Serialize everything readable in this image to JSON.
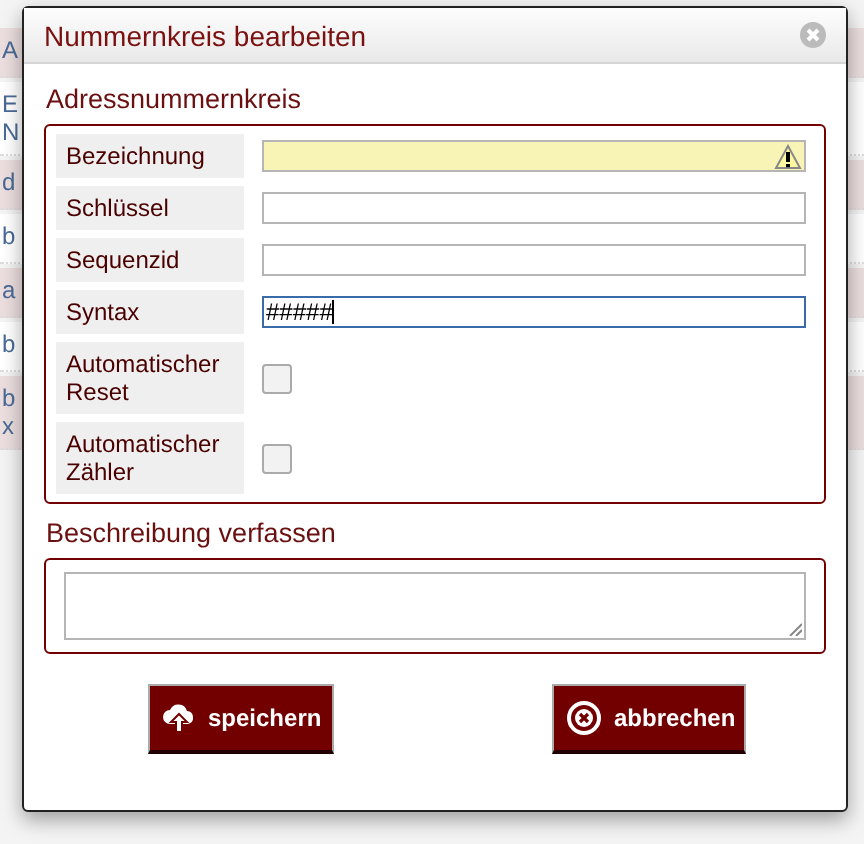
{
  "background_rows": [
    {
      "lines": [
        "A"
      ],
      "shaded": true
    },
    {
      "lines": [
        "E",
        "N"
      ],
      "shaded": false
    },
    {
      "lines": [
        "d"
      ],
      "shaded": true
    },
    {
      "lines": [
        "b"
      ],
      "shaded": false
    },
    {
      "lines": [
        "a"
      ],
      "shaded": true
    },
    {
      "lines": [
        "b"
      ],
      "shaded": false
    },
    {
      "lines": [
        "b",
        "x"
      ],
      "shaded": true
    }
  ],
  "dialog": {
    "title": "Nummernkreis bearbeiten",
    "section": {
      "title": "Adressnummernkreis",
      "fields": [
        {
          "kind": "text",
          "label": "Bezeichnung",
          "invalid": true,
          "focused": false
        },
        {
          "kind": "text",
          "label": "Schlüssel",
          "invalid": false,
          "focused": false
        },
        {
          "kind": "text",
          "label": "Sequenzid",
          "invalid": false,
          "focused": false
        },
        {
          "kind": "text",
          "label": "Syntax",
          "value": "#####",
          "invalid": false,
          "focused": true
        },
        {
          "kind": "checkbox",
          "label": "Automatischer Reset",
          "checked": false
        },
        {
          "kind": "checkbox",
          "label": "Automatischer Zähler",
          "checked": false
        }
      ]
    },
    "description": {
      "title": "Beschreibung verfassen"
    },
    "buttons": [
      {
        "kind": "save",
        "label": "speichern"
      },
      {
        "kind": "cancel",
        "label": "abbrechen"
      }
    ]
  }
}
